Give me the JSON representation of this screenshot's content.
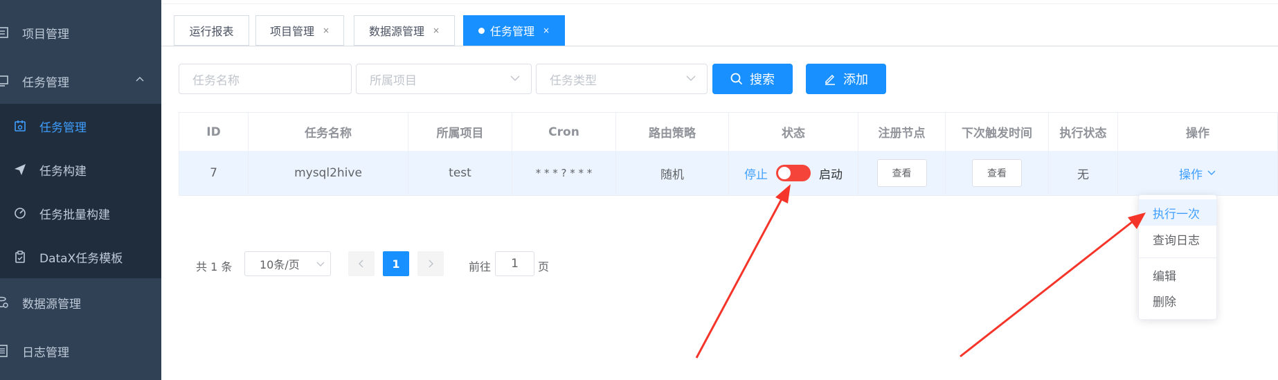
{
  "sidebar": {
    "items": [
      {
        "label": "项目管理",
        "icon": "project-icon"
      },
      {
        "label": "任务管理",
        "icon": "monitor-icon"
      },
      {
        "label": "数据源管理",
        "icon": "datasource-icon"
      },
      {
        "label": "日志管理",
        "icon": "log-icon"
      }
    ],
    "submenu": [
      {
        "label": "任务管理",
        "icon": "calendar-icon"
      },
      {
        "label": "任务构建",
        "icon": "send-icon"
      },
      {
        "label": "任务批量构建",
        "icon": "dashboard-icon"
      },
      {
        "label": "DataX任务模板",
        "icon": "clipboard-icon"
      }
    ]
  },
  "tabs": [
    {
      "label": "运行报表",
      "closable": false
    },
    {
      "label": "项目管理",
      "closable": true
    },
    {
      "label": "数据源管理",
      "closable": true
    },
    {
      "label": "任务管理",
      "closable": true,
      "active": true
    }
  ],
  "tab_close": "×",
  "filters": {
    "task_name_placeholder": "任务名称",
    "project_placeholder": "所属项目",
    "task_type_placeholder": "任务类型",
    "search_label": "搜索",
    "add_label": "添加"
  },
  "table": {
    "headers": [
      "ID",
      "任务名称",
      "所属项目",
      "Cron",
      "路由策略",
      "状态",
      "注册节点",
      "下次触发时间",
      "执行状态",
      "操作"
    ],
    "rows": [
      {
        "id": "7",
        "name": "mysql2hive",
        "project": "test",
        "cron": "* * * ? * * *",
        "route": "随机",
        "status_off": "停止",
        "status_on": "启动",
        "nodes_btn": "查看",
        "next_btn": "查看",
        "exec_status": "无",
        "op_label": "操作"
      }
    ]
  },
  "pagination": {
    "total": "共 1 条",
    "page_size": "10条/页",
    "current_page": "1",
    "goto_prefix": "前往",
    "goto_value": "1",
    "goto_suffix": "页"
  },
  "dropdown": {
    "items": [
      "执行一次",
      "查询日志",
      "编辑",
      "删除"
    ]
  },
  "colors": {
    "sidebar_bg": "#304156",
    "submenu_bg": "#1f2d3d",
    "primary": "#1890ff",
    "switch_off": "#f5443a",
    "arrow": "#f5352a"
  }
}
